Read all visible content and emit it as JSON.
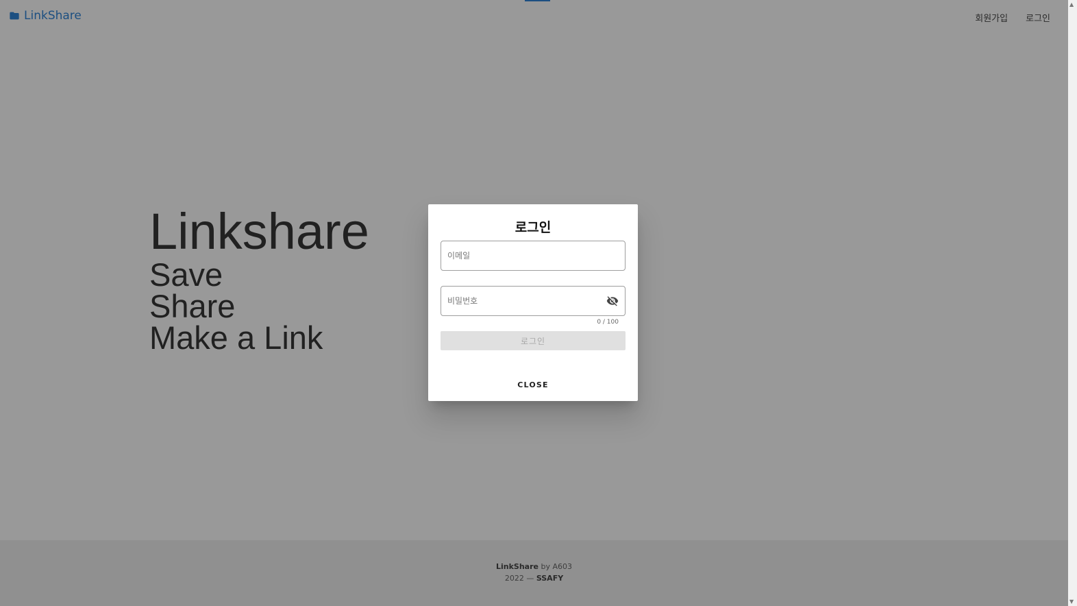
{
  "header": {
    "brand": "LinkShare",
    "brand_icon": "folder-icon",
    "brand_color": "#1976d2",
    "nav": {
      "signup": "회원가입",
      "login": "로그인"
    },
    "loading_progress": 0.2
  },
  "hero": {
    "title": "Linkshare",
    "lines": [
      "Save",
      "Share",
      "Make a Link"
    ]
  },
  "dialog": {
    "title": "로그인",
    "email_placeholder": "이메일",
    "password_placeholder": "비밀번호",
    "password_counter": "0 / 100",
    "password_toggle_icon": "eye-off-icon",
    "submit_label": "로그인",
    "close_label": "CLOSE"
  },
  "footer": {
    "brand": "LinkShare",
    "by_text": " by A603",
    "year_text": "2022 — ",
    "org": "SSAFY"
  }
}
